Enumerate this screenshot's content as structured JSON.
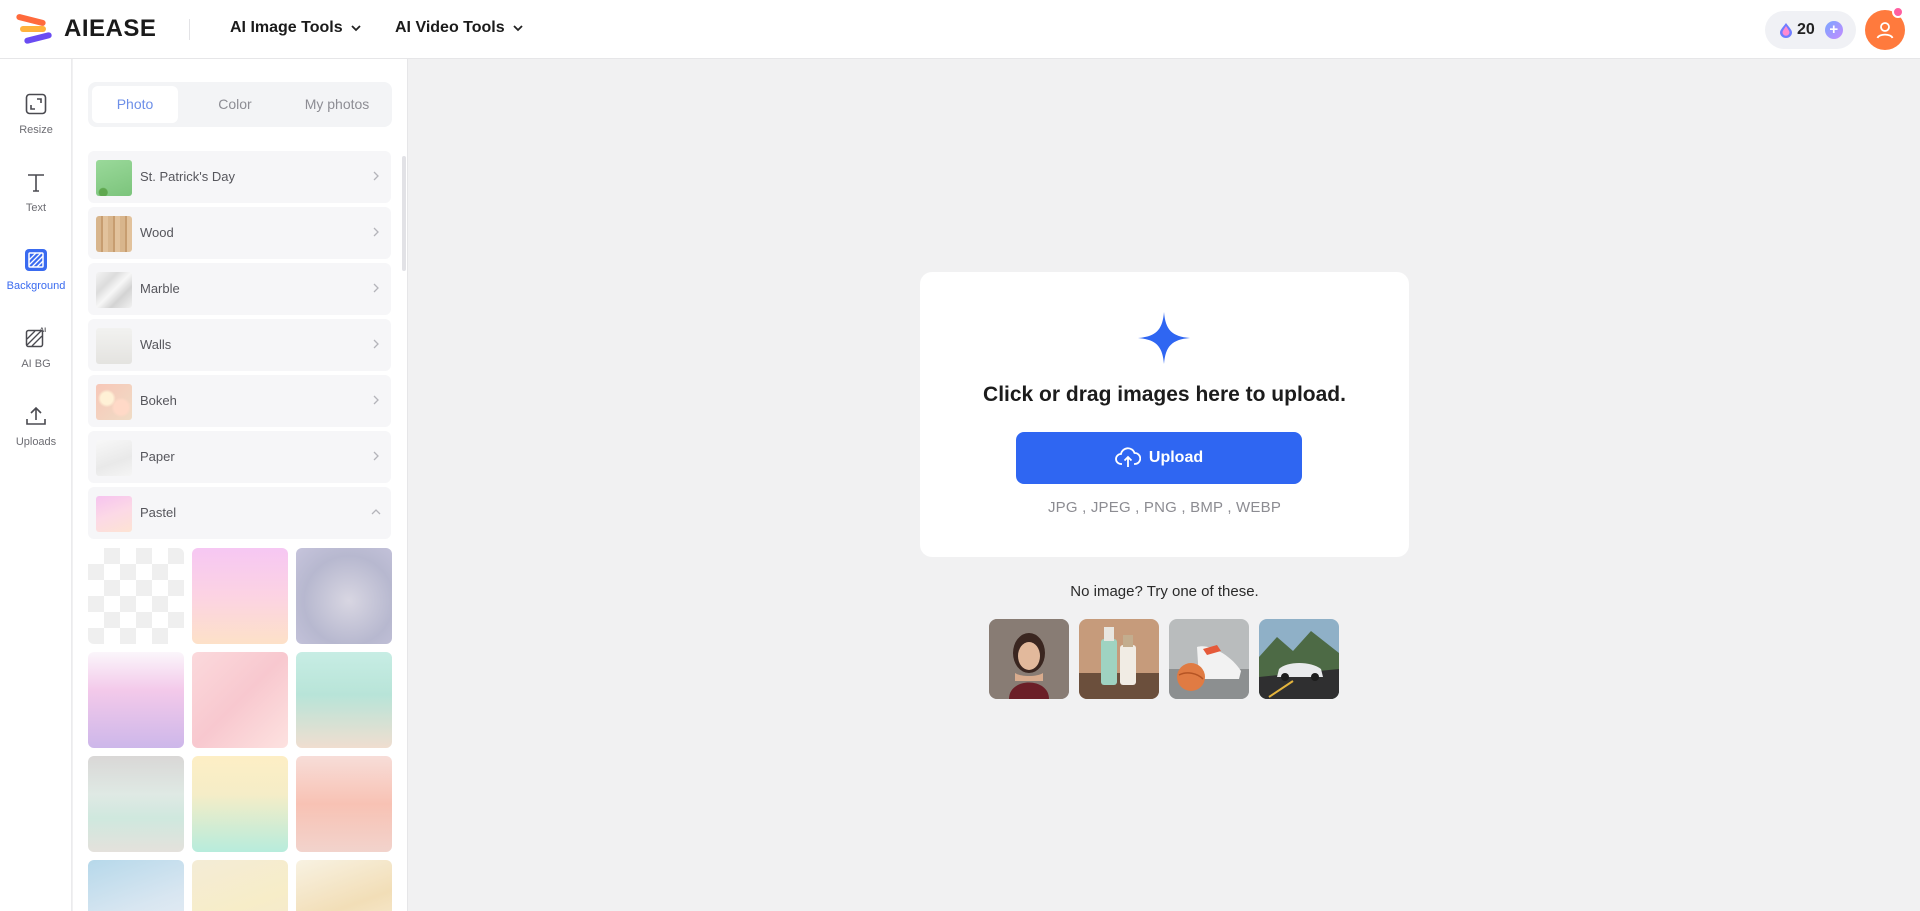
{
  "brand": {
    "name": "AIEASE"
  },
  "header": {
    "menus": [
      {
        "label": "AI Image Tools"
      },
      {
        "label": "AI Video Tools"
      }
    ],
    "credits": "20"
  },
  "rail": {
    "items": [
      {
        "label": "Resize",
        "icon": "resize-icon"
      },
      {
        "label": "Text",
        "icon": "text-icon"
      },
      {
        "label": "Background",
        "icon": "background-icon",
        "active": true
      },
      {
        "label": "AI BG",
        "icon": "ai-bg-icon"
      },
      {
        "label": "Uploads",
        "icon": "upload-icon"
      }
    ]
  },
  "panel": {
    "tabs": [
      {
        "label": "Photo",
        "active": true
      },
      {
        "label": "Color"
      },
      {
        "label": "My photos"
      }
    ],
    "categories": [
      {
        "name": "St. Patrick's Day",
        "state": "collapsed"
      },
      {
        "name": "Wood",
        "state": "collapsed"
      },
      {
        "name": "Marble",
        "state": "collapsed"
      },
      {
        "name": "Walls",
        "state": "collapsed"
      },
      {
        "name": "Bokeh",
        "state": "collapsed"
      },
      {
        "name": "Paper",
        "state": "collapsed"
      },
      {
        "name": "Pastel",
        "state": "expanded"
      }
    ]
  },
  "upload": {
    "title": "Click or drag images here to upload.",
    "button": "Upload",
    "formats": "JPG , JPEG , PNG , BMP , WEBP",
    "samples_label": "No image? Try one of these."
  },
  "colors": {
    "accent": "#2f66f2",
    "avatar": "#ff7a3d",
    "active_tab": "#6d8fe8"
  }
}
